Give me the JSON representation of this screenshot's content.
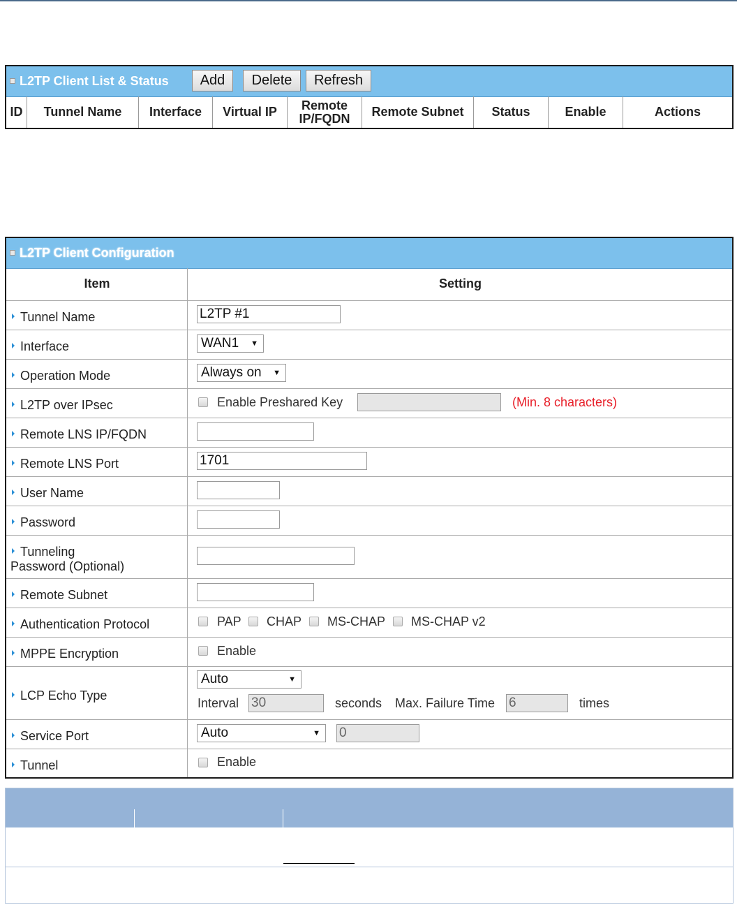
{
  "client_list": {
    "title": "L2TP Client List & Status",
    "buttons": {
      "add": "Add",
      "delete": "Delete",
      "refresh": "Refresh"
    },
    "columns": [
      "ID",
      "Tunnel Name",
      "Interface",
      "Virtual IP",
      "Remote\nIP/FQDN",
      "Remote Subnet",
      "Status",
      "Enable",
      "Actions"
    ]
  },
  "config": {
    "title": "L2TP Client Configuration",
    "header": {
      "item": "Item",
      "setting": "Setting"
    },
    "rows": {
      "tunnel_name": {
        "label": "Tunnel Name",
        "value": "L2TP #1"
      },
      "interface": {
        "label": "Interface",
        "value": "WAN1"
      },
      "operation_mode": {
        "label": "Operation Mode",
        "value": "Always on"
      },
      "l2tp_ipsec": {
        "label": "L2TP over IPsec",
        "checkbox_label": "Enable Preshared Key",
        "hint": "(Min. 8 characters)"
      },
      "remote_lns": {
        "label": "Remote LNS IP/FQDN",
        "value": ""
      },
      "remote_port": {
        "label": "Remote LNS Port",
        "value": "1701"
      },
      "user_name": {
        "label": "User Name",
        "value": ""
      },
      "password": {
        "label": "Password",
        "value": ""
      },
      "tunneling_password": {
        "label_line1": "Tunneling",
        "label_line2": "Password (Optional)",
        "value": ""
      },
      "remote_subnet": {
        "label": "Remote Subnet",
        "value": ""
      },
      "auth_protocol": {
        "label": "Authentication Protocol",
        "options": [
          "PAP",
          "CHAP",
          "MS-CHAP",
          "MS-CHAP v2"
        ]
      },
      "mppe": {
        "label": "MPPE Encryption",
        "checkbox_label": "Enable"
      },
      "lcp_echo": {
        "label": "LCP Echo Type",
        "value": "Auto",
        "interval_label": "Interval",
        "interval_value": "30",
        "seconds_label": "seconds",
        "max_failure_label": "Max. Failure Time",
        "max_failure_value": "6",
        "times_label": "times"
      },
      "service_port": {
        "label": "Service Port",
        "value": "Auto",
        "port_value": "0"
      },
      "tunnel": {
        "label": "Tunnel",
        "checkbox_label": "Enable"
      }
    }
  },
  "colors": {
    "header_bg": "#7cc0ec",
    "hint_red": "#e8202a",
    "bottom_table_head": "#95b3d7"
  }
}
